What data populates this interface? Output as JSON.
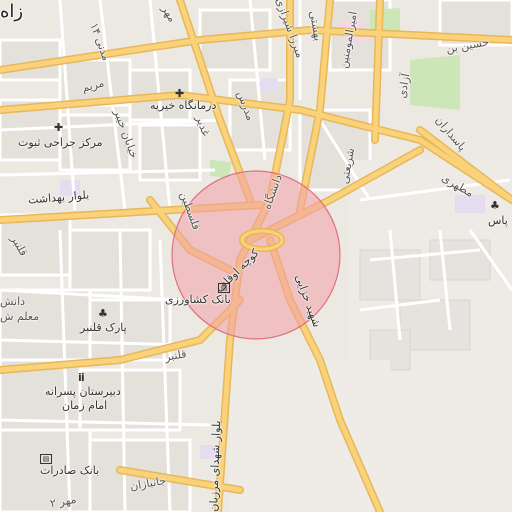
{
  "map": {
    "colors": {
      "background": "#f2efe9",
      "block": "#e6e3de",
      "minor_road": "#ffffff",
      "major_road": "#f9d27a",
      "major_road_casing": "#e8b75a",
      "park": "#cde6b8",
      "hospital_area": "#f3d8e4",
      "school_area": "#e6dcef",
      "highlight_circle_fill": "#f2a0a8",
      "highlight_circle_stroke": "#e07080"
    },
    "labels": {
      "top_left_city": "زاه",
      "street_modarres_top": "مدرس",
      "street_mehr": "مهر",
      "street_mizanshahr": "میرزا شیرازی",
      "street_beheshti_top": "بهشتی",
      "street_amir": "امیرالمومنین",
      "street_hosseini": "حسین بن",
      "street_azadi": "آزادی",
      "street_madani": "مدنی ۱۴",
      "street_maryam": "مریم",
      "street_khaibar": "خیابان خیبر",
      "street_ghadir": "غدیر",
      "street_modarres": "مدرس",
      "street_sharghi": "شریعتی",
      "street_pasdaran": "پاسداران",
      "street_motahari": "مطهری",
      "street_daneshgah": "دانشگاه",
      "street_beheshti_blvd": "بلوار بهداشت",
      "street_felestin": "فلسطین",
      "street_koocheh": "کوچه اوقاف",
      "street_shahid_khazai": "شهید خزایی",
      "street_ghanbar_left": "قلنبر",
      "street_ghanbar_low": "قلنبر",
      "street_shohada_blvd": "بلوار شهدای مرزبان",
      "street_janbaz": "جانبازان",
      "street_daneshgah_left": "دانش",
      "street_moalem": "معلم ش",
      "street_mahdi": "امام زمان",
      "street_mehr_bottom": "۲ مهر",
      "street_pas": "پاس"
    },
    "pois": {
      "clinic": "درمانگاه خیریه",
      "surgical_center": "مرکز جراحی ثبوت",
      "bank_keshavarzi": "بانک کشاورزی",
      "park_ghanbar": "پارک قلنبر",
      "school_line1": "دبیرستان پسرانه",
      "school_line2": "امام زمان",
      "bank_saderat": "بانک صادرات"
    },
    "icons": {
      "clinic": "cross-icon",
      "surgical_center": "cross-icon",
      "bank_keshavarzi": "bank-icon",
      "park_ghanbar": "tree-icon",
      "school": "school-icon",
      "bank_saderat": "bank-icon",
      "park_right": "tree-icon"
    }
  }
}
